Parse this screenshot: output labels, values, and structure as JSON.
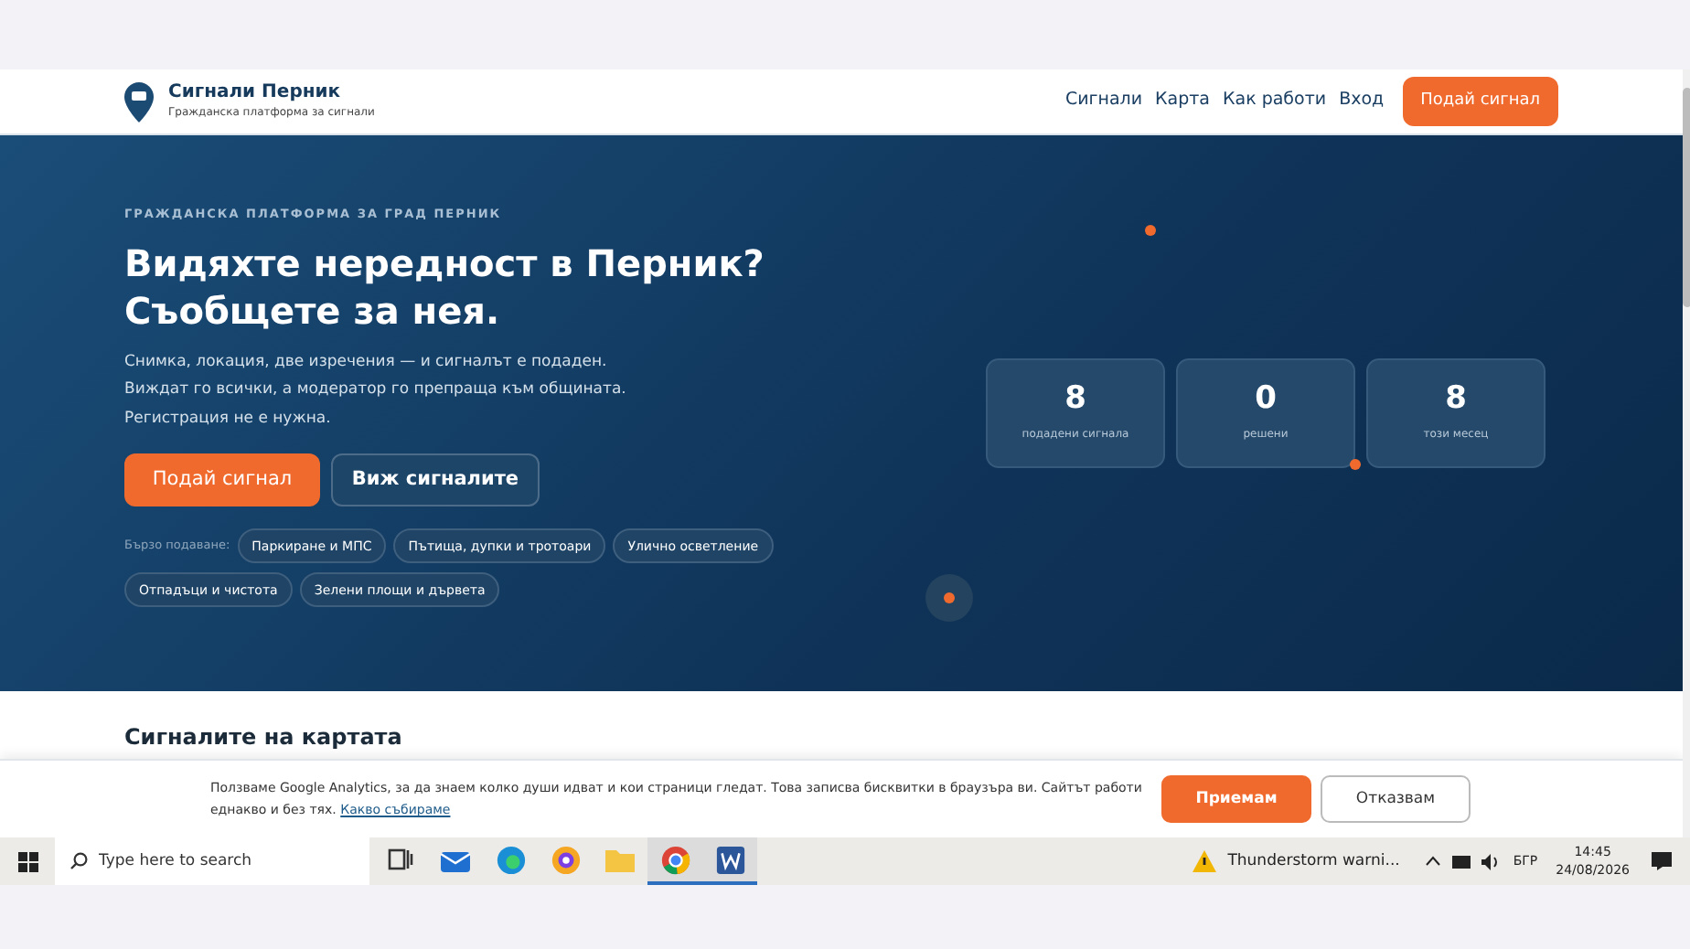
{
  "header": {
    "brand": "Сигнали Перник",
    "tagline": "Гражданска платформа за сигнали",
    "nav": [
      "Сигнали",
      "Карта",
      "Как работи",
      "Вход"
    ],
    "cta": "Подай сигнал"
  },
  "hero": {
    "eyebrow": "ГРАЖДАНСКА ПЛАТФОРМА ЗА ГРАД ПЕРНИК",
    "title_lines": [
      "Видяхте нередност в Перник?",
      "Съобщете за нея."
    ],
    "description_lines": [
      "Снимка, локация, две изречения — и сигналът е подаден.",
      "Виждат го всички, а модератор го препраща към общината.",
      "Регистрация не е нужна."
    ],
    "primary_button": "Подай сигнал",
    "secondary_button": "Виж сигналите",
    "quick_label": "Бързо подаване:",
    "quick_tags": [
      "Паркиране и МПС",
      "Пътища, дупки и тротоари",
      "Улично осветление",
      "Отпадъци и чистота",
      "Зелени площи и дървета"
    ],
    "stats": [
      {
        "value": "8",
        "label": "подадени сигнала"
      },
      {
        "value": "0",
        "label": "решени"
      },
      {
        "value": "8",
        "label": "този месец"
      }
    ]
  },
  "map_section": {
    "title": "Сигналите на картата"
  },
  "cookie_banner": {
    "text": "Ползваме Google Analytics, за да знаем колко души идват и кои страници гледат. Това записва бисквитки в браузъра ви. Сайтът работи еднакво и без тях.",
    "link": "Какво събираме",
    "accept": "Приемам",
    "decline": "Отказвам"
  },
  "taskbar": {
    "search_placeholder": "Type here to search",
    "apps": [
      {
        "kind": "taskview",
        "selected": false
      },
      {
        "kind": "mail",
        "selected": false
      },
      {
        "kind": "edge",
        "selected": false
      },
      {
        "kind": "browser",
        "selected": false
      },
      {
        "kind": "folder",
        "selected": false
      },
      {
        "kind": "chrome",
        "selected": true
      },
      {
        "kind": "word",
        "selected": true
      }
    ],
    "weather": "Thunderstorm warni...",
    "language": "БГР",
    "time": "14:45",
    "date": "24/08/2026"
  }
}
